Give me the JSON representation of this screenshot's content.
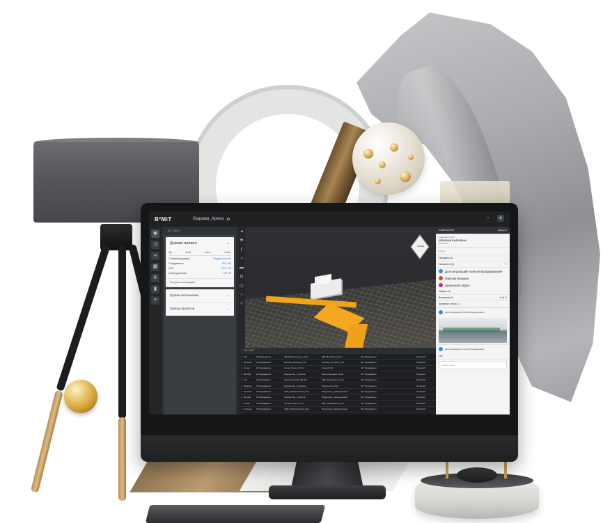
{
  "app": {
    "logo": "B²MiT",
    "project_title": "Ледовая_Арена",
    "gear_icon": "gear-icon",
    "top_icons": [
      "window-icon",
      "settings-icon"
    ]
  },
  "left_sidebar": {
    "icons": [
      "eye-icon",
      "shuffle-icon",
      "link-icon",
      "grid-icon",
      "puzzle-icon",
      "chart-icon",
      "list-icon"
    ]
  },
  "left_panel": {
    "header": "ИЗ. КАРТ.",
    "tree_title": "Дерево правил",
    "table_headers": [
      "ИД",
      "Слой",
      "Класс",
      "Отмен"
    ],
    "table_rows": [
      {
        "label": "1 Раскрытие данных",
        "value": "Выделено все об"
      },
      {
        "label": "2 Фундаменты",
        "value": "335 / 335"
      },
      {
        "label": "3 АР",
        "value": "1215 / 212"
      },
      {
        "label": "4 Конструктивное",
        "value": "730 / 95"
      }
    ],
    "footer": "По группе конструкций",
    "groups": [
      "Группы исполнения",
      "Группы проектов"
    ]
  },
  "toolstrip": {
    "icons": [
      "arrow-icon",
      "move-icon",
      "walk-icon",
      "camera-icon",
      "folder-icon",
      "measure-icon",
      "section-icon",
      "eye-small-icon",
      "shape-icon"
    ]
  },
  "viewport": {
    "viewcube_label": "ПЕРЕД"
  },
  "table_panel": {
    "header": "ИЗ. КАРТ.",
    "rows": [
      [
        "≡",
        "ЖБ",
        "ИЗ Фундаменты",
        "ЖБ_Прямоугольная_опор",
        "АВК_Монолитный рост",
        "АР / Фундаменты",
        "",
        "Отмен ЕЛ"
      ],
      [
        "≡",
        "Колонны",
        "АР-Фундаменты",
        "Колонны_Колонна_1 СР",
        "Колонны_Колонны_1 СР",
        "АР / Фундаменты",
        "",
        "Отмен ЕЛ"
      ],
      [
        "≡",
        "Стены",
        "АР-Фундаменты",
        "Стены_Стена_1 Тип 4",
        "Стены 20 [к]",
        "АР / Фундаменты",
        "",
        "Отмен ЕЛ"
      ],
      [
        "≡",
        "Монтаж",
        "АР-Фундаменты",
        "Перекрытие_1_Монтаж",
        "Вентиляционные плиты",
        "АР / Фундаменты",
        "",
        "Отмен ЕЛ"
      ],
      [
        "≡",
        "ЖБ",
        "АР-Фундаменты",
        "Защитный слой_АВК_Бет",
        "АВК_Перекрытие_А_тип",
        "АР / Фундаменты",
        "",
        "Отмен ЕЛ"
      ],
      [
        "≡",
        "Разделы",
        "АР-Фундаменты",
        "Перекрытие_1_Разделы",
        "Перекрытие 20 [к]",
        "АР / Фундаменты",
        "",
        "Отмен ЕЛ"
      ],
      [
        "≡",
        "Колонны",
        "АР-Фундаменты",
        "СЖБ_Прямоугольная_опор",
        "Воздуховод_прямоугольный",
        "АР / Фундаменты",
        "",
        "Отмен ЕЛ"
      ],
      [
        "≡",
        "Монтаж",
        "АР-Фундаменты",
        "Перекрытие_1_Монтаж",
        "Воздуховод_прямоугольный",
        "АР / Фундаменты",
        "",
        "Отмен ЕЛ"
      ],
      [
        "≡",
        "Стены",
        "АР-Фундаменты",
        "Стены_Стена_1 Тип 4",
        "АВК_Перекрытие_А_тип",
        "АР / Фундаменты",
        "",
        "Отмен ЕЛ"
      ],
      [
        "≡",
        "Колонны",
        "АР-Фундаменты",
        "СЖБ_Прямоугольная_опор",
        "Воздуховод_прямоугольный",
        "АР / Фундаменты",
        "",
        "Отмен ЕЛ"
      ],
      [
        "≡",
        "Монтаж",
        "АР-Фундаменты",
        "Перекрытие_1_Монтаж",
        "Воздуховод_прямоугольный",
        "АР / Фундаменты",
        "",
        "Отмен ЕЛ"
      ]
    ]
  },
  "right_panel": {
    "tab_left": "ЗАМЕЧАНИЕ",
    "tab_right": "закрыть",
    "issue_label": "Замечание ИД 2",
    "issue_title": "Шпильки выбиваны",
    "issue_sub": "Описание",
    "status_label": "Статус",
    "line_1": "Передано (1)",
    "line_2": "Назначено (3)",
    "users": [
      {
        "name": "Долгоиграющий Алексей Владимирович",
        "color": "#2f8fd1"
      },
      {
        "name": "Максим Мышкин",
        "color": "#d14a2f"
      },
      {
        "name": "Шейшеков Айдел",
        "color": "#c0307a"
      }
    ],
    "line_3": "Модель (1)",
    "line_4": "Вложения (1)",
    "line_5": "Активные точки (1)",
    "comment_author_1": "Долгоиграющий Алексей Владимирович",
    "comment_author_2": "Долгоиграющий Алексей Владимирович",
    "comment_text": "Ок?",
    "input_placeholder": "Комментарий..."
  }
}
